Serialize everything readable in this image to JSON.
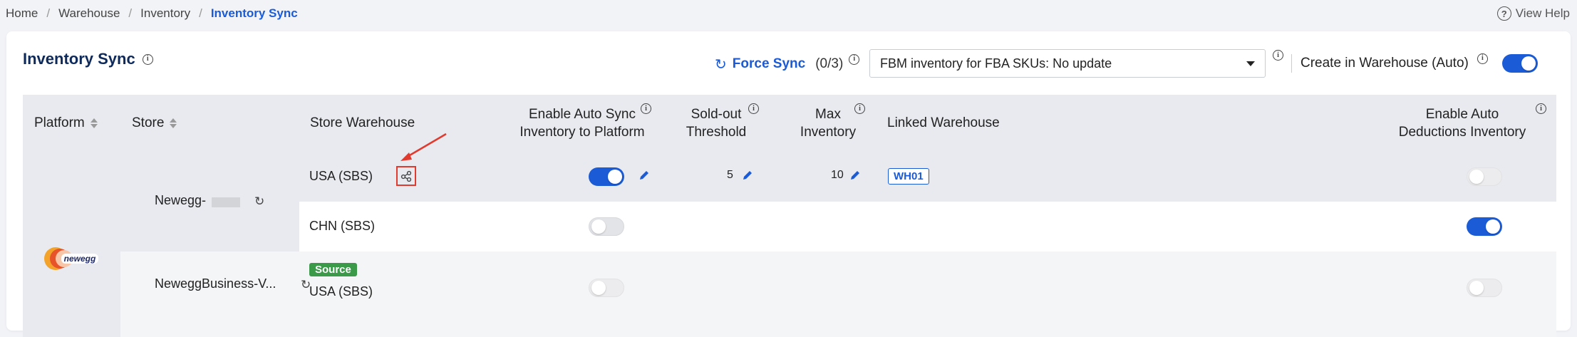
{
  "breadcrumb": {
    "items": [
      "Home",
      "Warehouse",
      "Inventory"
    ],
    "current": "Inventory Sync"
  },
  "help": {
    "label": "View Help",
    "icon": "question-circle-icon"
  },
  "page": {
    "title": "Inventory Sync"
  },
  "toolbar": {
    "force_sync_label": "Force Sync",
    "force_sync_count": "(0/3)",
    "fbm_select_value": "FBM inventory for FBA SKUs: No update",
    "create_label": "Create in Warehouse (Auto)",
    "create_enabled": true
  },
  "table": {
    "columns": {
      "platform": "Platform",
      "store": "Store",
      "store_warehouse": "Store Warehouse",
      "auto_sync_1": "Enable Auto Sync",
      "auto_sync_2": "Inventory to Platform",
      "soldout_1": "Sold-out",
      "soldout_2": "Threshold",
      "max_1": "Max",
      "max_2": "Inventory",
      "linked": "Linked Warehouse",
      "deductions_1": "Enable Auto",
      "deductions_2": "Deductions Inventory"
    },
    "platform_logo_text": "newegg",
    "stores": [
      {
        "name": "Newegg-",
        "rows": [
          {
            "warehouse": "USA (SBS)",
            "auto_sync": "on",
            "sold_out": "5",
            "max_inventory": "10",
            "linked": "WH01",
            "deductions": "disabled"
          },
          {
            "warehouse": "CHN (SBS)",
            "auto_sync": "off",
            "sold_out": "",
            "max_inventory": "",
            "linked": "",
            "deductions": "on"
          }
        ]
      },
      {
        "name": "NeweggBusiness-V...",
        "rows": [
          {
            "badge": "Source",
            "warehouse": "USA (SBS)",
            "auto_sync": "disabled",
            "deductions": "disabled"
          }
        ]
      }
    ]
  },
  "colors": {
    "accent": "#1b5bd6",
    "source_badge": "#3a9a4a",
    "annotation": "#e03b2e"
  }
}
